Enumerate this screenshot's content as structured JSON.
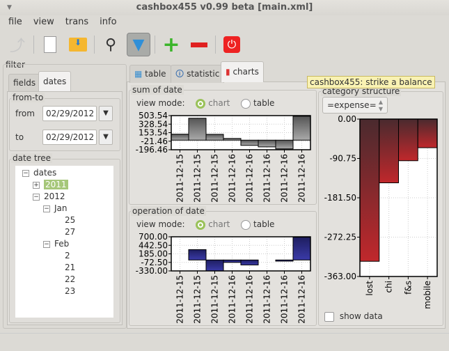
{
  "window": {
    "title": "cashbox455 v0.99 beta [main.xml]"
  },
  "menu": [
    "file",
    "view",
    "trans",
    "info"
  ],
  "tooltip": "cashbox455: strike a balance",
  "filter": {
    "title": "filter",
    "tabs": [
      "fields",
      "dates"
    ],
    "fromto_title": "from-to",
    "from_label": "from",
    "from_value": "02/29/2012",
    "to_label": "to",
    "to_value": "02/29/2012",
    "tree_title": "date tree",
    "tree": [
      {
        "label": "dates",
        "level": 0,
        "tog": "−"
      },
      {
        "label": "2011",
        "level": 1,
        "tog": "+",
        "sel": true
      },
      {
        "label": "2012",
        "level": 1,
        "tog": "−"
      },
      {
        "label": "Jan",
        "level": 2,
        "tog": "−"
      },
      {
        "label": "25",
        "level": 3
      },
      {
        "label": "27",
        "level": 3
      },
      {
        "label": "Feb",
        "level": 2,
        "tog": "−"
      },
      {
        "label": "2",
        "level": 3
      },
      {
        "label": "21",
        "level": 3
      },
      {
        "label": "22",
        "level": 3
      },
      {
        "label": "23",
        "level": 3
      }
    ]
  },
  "main_tabs": [
    "table",
    "statistic",
    "charts"
  ],
  "view_mode": {
    "label": "view mode:",
    "chart": "chart",
    "table": "table"
  },
  "category": {
    "select": "=expense=",
    "show_data": "show data"
  },
  "colors": {
    "sum": "#777777",
    "op": "#2e2e8a",
    "cat": "#b02a2a"
  },
  "chart_data": [
    {
      "type": "bar",
      "title": "sum of date",
      "categories": [
        "2011-12-15",
        "2011-12-15",
        "2011-12-15",
        "2011-12-16",
        "2011-12-16",
        "2011-12-16",
        "2011-12-16",
        "2011-12-16"
      ],
      "values": [
        123,
        450,
        120,
        35,
        -107,
        -138,
        -179,
        491
      ],
      "yticks": [
        "503.54",
        "328.54",
        "153.54",
        "-21.46",
        "-196.46"
      ],
      "ylim": [
        -196.46,
        503.54
      ]
    },
    {
      "type": "bar",
      "title": "operation of date",
      "categories": [
        "2011-12-15",
        "2011-12-15",
        "2011-12-15",
        "2011-12-16",
        "2011-12-16",
        "2011-12-16",
        "2011-12-16",
        "2011-12-16"
      ],
      "values": [
        0,
        313,
        -330,
        -74,
        -150,
        0,
        -35,
        687
      ],
      "yticks": [
        "700.00",
        "442.50",
        "185.00",
        "-72.50",
        "-330.00"
      ],
      "ylim": [
        -330,
        700
      ]
    },
    {
      "type": "bar",
      "title": "category structure",
      "categories": [
        "lost",
        "chi",
        "f&s",
        "mobile"
      ],
      "values": [
        -328,
        -147,
        -96,
        -66
      ],
      "yticks": [
        "0.00",
        "-90.75",
        "-181.50",
        "-272.25",
        "-363.00"
      ],
      "ylim": [
        -363,
        0
      ]
    }
  ]
}
